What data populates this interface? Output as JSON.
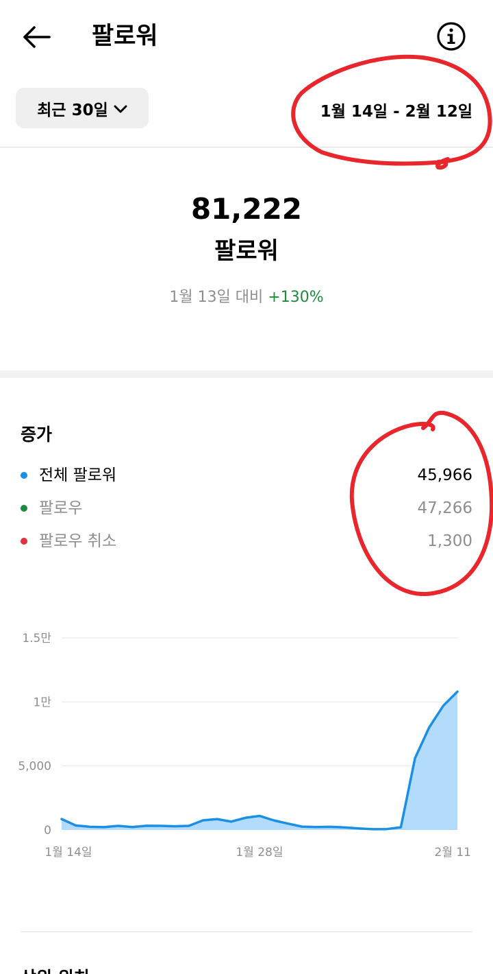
{
  "header": {
    "back_icon": "arrow-left-icon",
    "title": "팔로워",
    "info_icon": "info-circle-icon"
  },
  "filter": {
    "range_label": "최근 30일",
    "chevron_icon": "chevron-down-icon",
    "date_range": "1월 14일 - 2월 12일"
  },
  "summary": {
    "count": "81,222",
    "label": "팔로워",
    "compare_prefix": "1월 13일 대비",
    "compare_delta": "+130%"
  },
  "growth": {
    "title": "증가",
    "rows": [
      {
        "label": "전체 팔로워",
        "value": "45,966",
        "color": "#1a8fe3"
      },
      {
        "label": "팔로우",
        "value": "47,266",
        "color": "#1e8a3a"
      },
      {
        "label": "팔로우 취소",
        "value": "1,300",
        "color": "#e0313d"
      }
    ]
  },
  "chart_data": {
    "type": "area",
    "y_tick_labels": [
      "1.5만",
      "1만",
      "5,000",
      "0"
    ],
    "y_ticks": [
      15000,
      10000,
      5000,
      0
    ],
    "ylim": [
      0,
      15000
    ],
    "x_tick_labels": [
      "1월 14일",
      "1월 28일",
      "2월 11"
    ],
    "x_tick_index": [
      0,
      14,
      28
    ],
    "grid": true,
    "line_color": "#1a8fe3",
    "fill_color": "#b3dbfb",
    "series": [
      {
        "values": [
          850,
          350,
          250,
          220,
          320,
          230,
          330,
          320,
          290,
          320,
          750,
          850,
          650,
          950,
          1100,
          750,
          500,
          260,
          230,
          250,
          200,
          120,
          60,
          70,
          210,
          5600,
          8000,
          9700,
          10800
        ]
      }
    ]
  },
  "next_section": {
    "title": "상위 위치"
  },
  "annotation_color": "#e8262b"
}
